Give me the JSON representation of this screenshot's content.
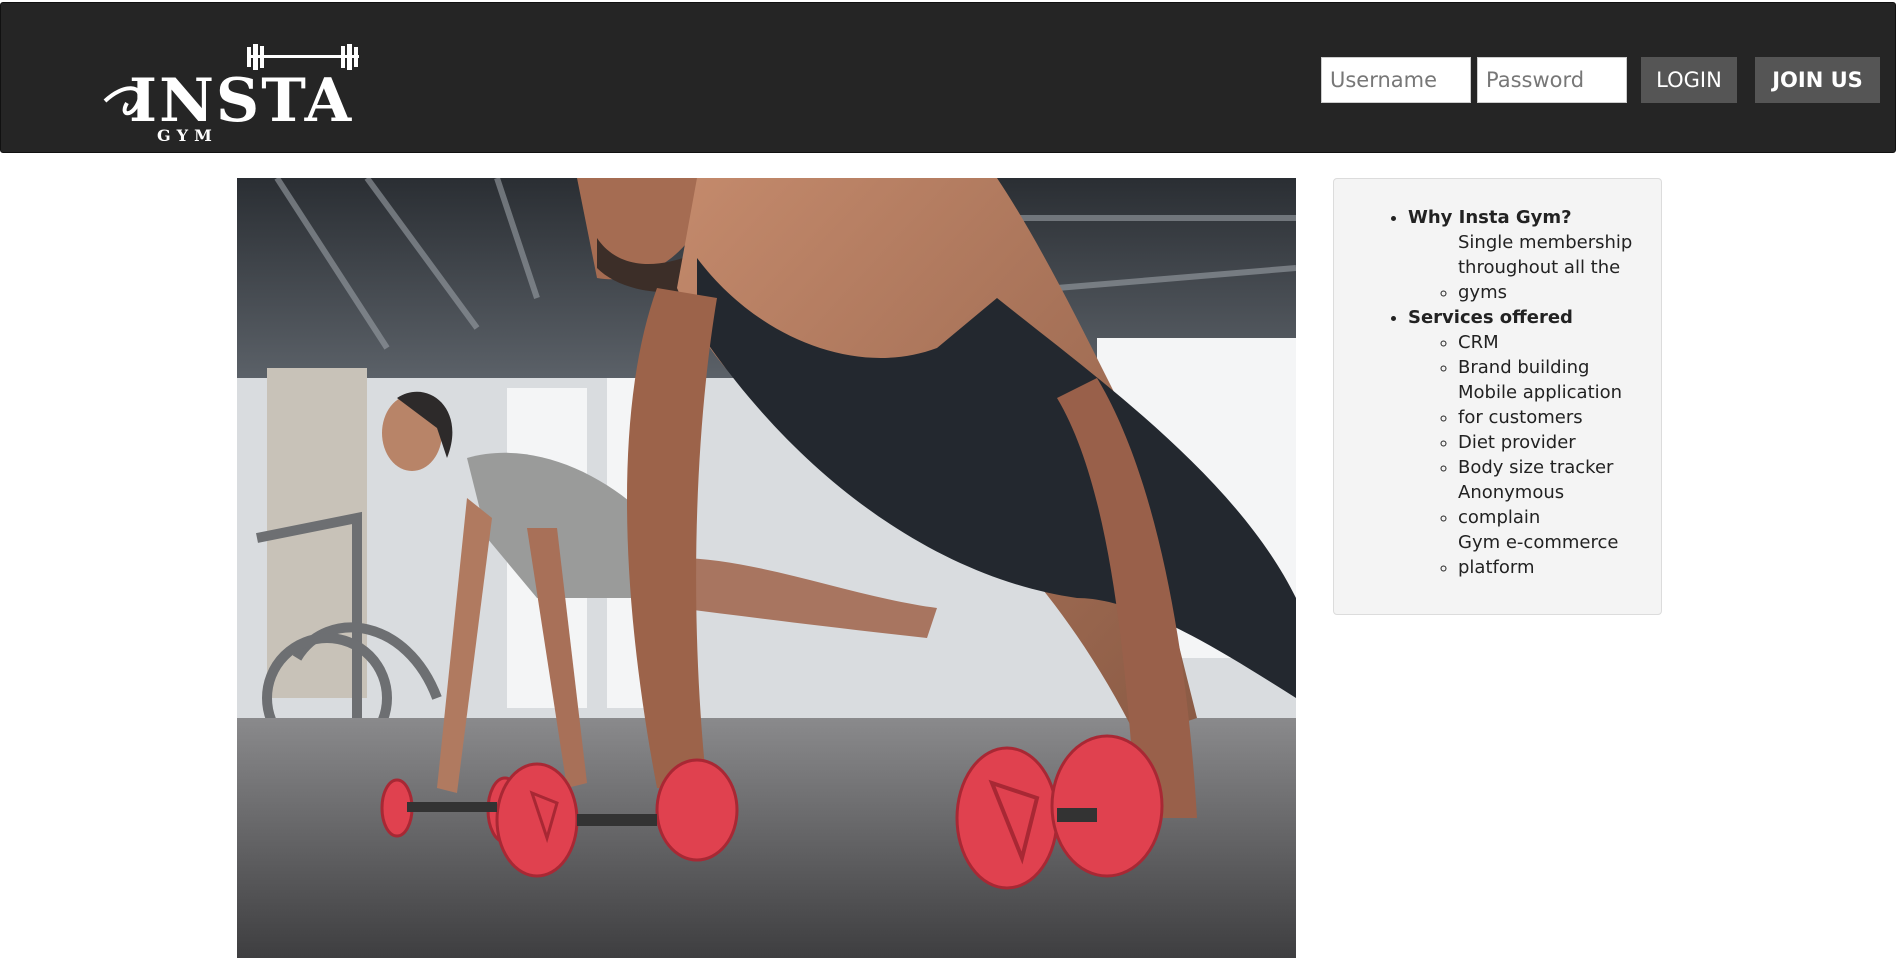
{
  "header": {
    "logo": {
      "main_text": "INSTA",
      "sub_text": "GYM"
    },
    "username_placeholder": "Username",
    "password_placeholder": "Password",
    "login_label": "LOGIN",
    "join_label": "JOIN US"
  },
  "hero": {
    "image": "gym-push-up-photo"
  },
  "sidebar": {
    "sections": [
      {
        "title": "Why Insta Gym?",
        "items": [
          "Single membership throughout all the gyms"
        ]
      },
      {
        "title": "Services offered",
        "items": [
          "CRM",
          "Brand building",
          "Mobile application for customers",
          "Diet provider",
          "Body size tracker",
          "Anonymous complain",
          "Gym e-commerce platform"
        ]
      }
    ]
  },
  "colors": {
    "navbar_bg": "#252525",
    "button_bg": "#555555",
    "sidebar_bg": "#f4f4f4",
    "dumbbell_red": "#e0414f"
  }
}
